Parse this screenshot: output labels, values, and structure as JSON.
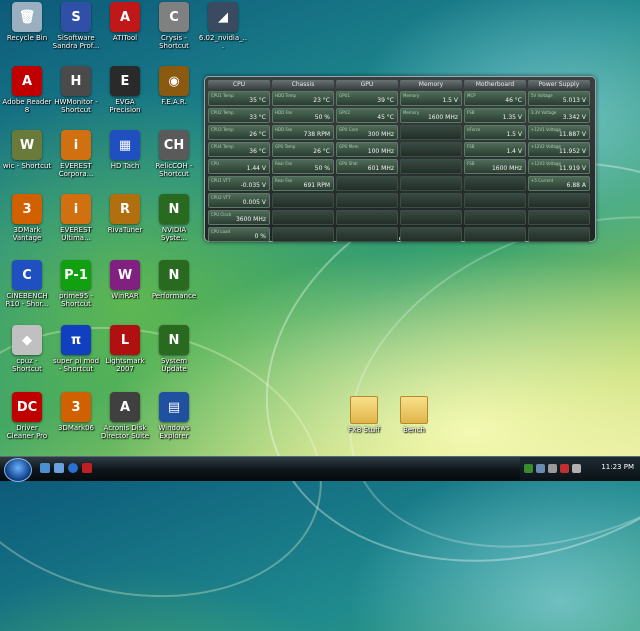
{
  "desktop_icons": [
    {
      "id": "recycle",
      "label": "Recycle Bin",
      "glyph": "🗑",
      "color": "#9ab0c0"
    },
    {
      "id": "sisoft",
      "label": "SiSoftware Sandra Prof...",
      "glyph": "S",
      "color": "#3050a8"
    },
    {
      "id": "atitool",
      "label": "ATITool",
      "glyph": "A",
      "color": "#c01818"
    },
    {
      "id": "crysis",
      "label": "Crysis - Shortcut",
      "glyph": "C",
      "color": "#808080"
    },
    {
      "id": "nvidia",
      "label": "6.02_nvidia_...",
      "glyph": "◢",
      "color": "#3a4a60"
    },
    {
      "id": "adobe",
      "label": "Adobe Reader 8",
      "glyph": "A",
      "color": "#c00000"
    },
    {
      "id": "hwmon",
      "label": "HWMonitor - Shortcut",
      "glyph": "H",
      "color": "#4a4a4a"
    },
    {
      "id": "evga",
      "label": "EVGA Precision",
      "glyph": "E",
      "color": "#2a2a2a"
    },
    {
      "id": "fear",
      "label": "F.E.A.R.",
      "glyph": "◉",
      "color": "#8a5a10"
    },
    {
      "id": "wic",
      "label": "wic - Shortcut",
      "glyph": "W",
      "color": "#6a7a3a"
    },
    {
      "id": "everest1",
      "label": "EVEREST Corpora...",
      "glyph": "i",
      "color": "#d07010"
    },
    {
      "id": "hdtach",
      "label": "HD Tach",
      "glyph": "▦",
      "color": "#2050c0"
    },
    {
      "id": "reliccoh",
      "label": "RelicCOH - Shortcut",
      "glyph": "CH",
      "color": "#5a5a5a"
    },
    {
      "id": "3dmark",
      "label": "3DMark Vantage",
      "glyph": "3",
      "color": "#d06000"
    },
    {
      "id": "everest2",
      "label": "EVEREST Ultima...",
      "glyph": "i",
      "color": "#d07010"
    },
    {
      "id": "rivatuner",
      "label": "RivaTuner",
      "glyph": "R",
      "color": "#b07010"
    },
    {
      "id": "nvsys",
      "label": "NVIDIA Syste...",
      "glyph": "N",
      "color": "#2a6a20"
    },
    {
      "id": "cinebench",
      "label": "CINEBENCH R10 - Shor...",
      "glyph": "C",
      "color": "#2050c0"
    },
    {
      "id": "prime95",
      "label": "prime95 - Shortcut",
      "glyph": "P-1",
      "color": "#10a010"
    },
    {
      "id": "winrar",
      "label": "WinRAR",
      "glyph": "W",
      "color": "#802080"
    },
    {
      "id": "performance",
      "label": "Performance",
      "glyph": "N",
      "color": "#2a6a20"
    },
    {
      "id": "cpuz",
      "label": "cpuz - Shortcut",
      "glyph": "◆",
      "color": "#c0c0c0"
    },
    {
      "id": "superpi",
      "label": "super pi mod - Shortcut",
      "glyph": "π",
      "color": "#1040c0"
    },
    {
      "id": "lightsmark",
      "label": "Lightsmark 2007",
      "glyph": "L",
      "color": "#b01010"
    },
    {
      "id": "sysupdate",
      "label": "System Update",
      "glyph": "N",
      "color": "#2a6a20"
    },
    {
      "id": "drivercleaner",
      "label": "Driver Cleaner Pro",
      "glyph": "DC",
      "color": "#c00000"
    },
    {
      "id": "3dmark06",
      "label": "3DMark06",
      "glyph": "3",
      "color": "#d06000"
    },
    {
      "id": "acronis",
      "label": "Acronis Disk Director Suite",
      "glyph": "A",
      "color": "#404040"
    },
    {
      "id": "winexplorer",
      "label": "Windows Explorer",
      "glyph": "▤",
      "color": "#2050a0"
    }
  ],
  "gadget": {
    "columns": [
      {
        "header": "CPU",
        "cells": [
          {
            "label": "CPU1 Temp",
            "value": "35 °C"
          },
          {
            "label": "CPU2 Temp",
            "value": "33 °C"
          },
          {
            "label": "CPU3 Temp",
            "value": "26 °C"
          },
          {
            "label": "CPU4 Temp",
            "value": "36 °C"
          },
          {
            "label": "CPU",
            "value": "1.44 V"
          },
          {
            "label": "CPU1 VTT",
            "value": "-0.035 V"
          },
          {
            "label": "CPU2 VTT",
            "value": "0.005 V"
          },
          {
            "label": "CPU Clock",
            "value": "3600 MHz"
          },
          {
            "label": "CPU Load",
            "value": "0 %"
          }
        ]
      },
      {
        "header": "Chassis",
        "cells": [
          {
            "label": "HDD Temp",
            "value": "23 °C"
          },
          {
            "label": "HDD Fan",
            "value": "50 %"
          },
          {
            "label": "HDD Fan",
            "value": "738 RPM"
          },
          {
            "label": "GPU Temp",
            "value": "26 °C"
          },
          {
            "label": "Rear Fan",
            "value": "50 %"
          },
          {
            "label": "Rear Fan",
            "value": "691 RPM"
          },
          {
            "label": "",
            "value": ""
          },
          {
            "label": "",
            "value": ""
          },
          {
            "label": "",
            "value": ""
          }
        ]
      },
      {
        "header": "GPU",
        "cells": [
          {
            "label": "GPU1",
            "value": "39 °C"
          },
          {
            "label": "GPU2",
            "value": "45 °C"
          },
          {
            "label": "GPU Core",
            "value": "300 MHz"
          },
          {
            "label": "GPU Mem",
            "value": "100 MHz"
          },
          {
            "label": "GPU Shdr",
            "value": "601 MHz"
          },
          {
            "label": "",
            "value": ""
          },
          {
            "label": "",
            "value": ""
          },
          {
            "label": "",
            "value": ""
          },
          {
            "label": "",
            "value": ""
          }
        ]
      },
      {
        "header": "Memory",
        "cells": [
          {
            "label": "Memory",
            "value": "1.5 V"
          },
          {
            "label": "Memory",
            "value": "1600 MHz"
          },
          {
            "label": "",
            "value": ""
          },
          {
            "label": "",
            "value": ""
          },
          {
            "label": "",
            "value": ""
          },
          {
            "label": "",
            "value": ""
          },
          {
            "label": "",
            "value": ""
          },
          {
            "label": "",
            "value": ""
          },
          {
            "label": "",
            "value": ""
          }
        ]
      },
      {
        "header": "Motherboard",
        "cells": [
          {
            "label": "MCP",
            "value": "46 °C"
          },
          {
            "label": "FSB",
            "value": "1.35 V"
          },
          {
            "label": "nForce",
            "value": "1.5 V"
          },
          {
            "label": "FSB",
            "value": "1.4 V"
          },
          {
            "label": "FSB",
            "value": "1600 MHz"
          },
          {
            "label": "",
            "value": ""
          },
          {
            "label": "",
            "value": ""
          },
          {
            "label": "",
            "value": ""
          },
          {
            "label": "",
            "value": ""
          }
        ]
      },
      {
        "header": "Power Supply",
        "cells": [
          {
            "label": "5V Voltage",
            "value": "5.013 V"
          },
          {
            "label": "3.3V Voltage",
            "value": "3.342 V"
          },
          {
            "label": "+12V1 Voltage",
            "value": "11.887 V"
          },
          {
            "label": "+12V2 Voltage",
            "value": "11.952 V"
          },
          {
            "label": "+12V3 Voltage",
            "value": "11.919 V"
          },
          {
            "label": "+5 Current",
            "value": "6.88 A"
          },
          {
            "label": "",
            "value": ""
          },
          {
            "label": "",
            "value": ""
          },
          {
            "label": "",
            "value": ""
          }
        ]
      }
    ]
  },
  "folders": [
    {
      "id": "fx",
      "label": "FX8 Stuff"
    },
    {
      "id": "bench",
      "label": "Bench"
    }
  ],
  "taskbar": {
    "clock": "11:23 PM"
  },
  "colors": {
    "accent": "#3aa26a",
    "taskbar": "#0d1418"
  }
}
